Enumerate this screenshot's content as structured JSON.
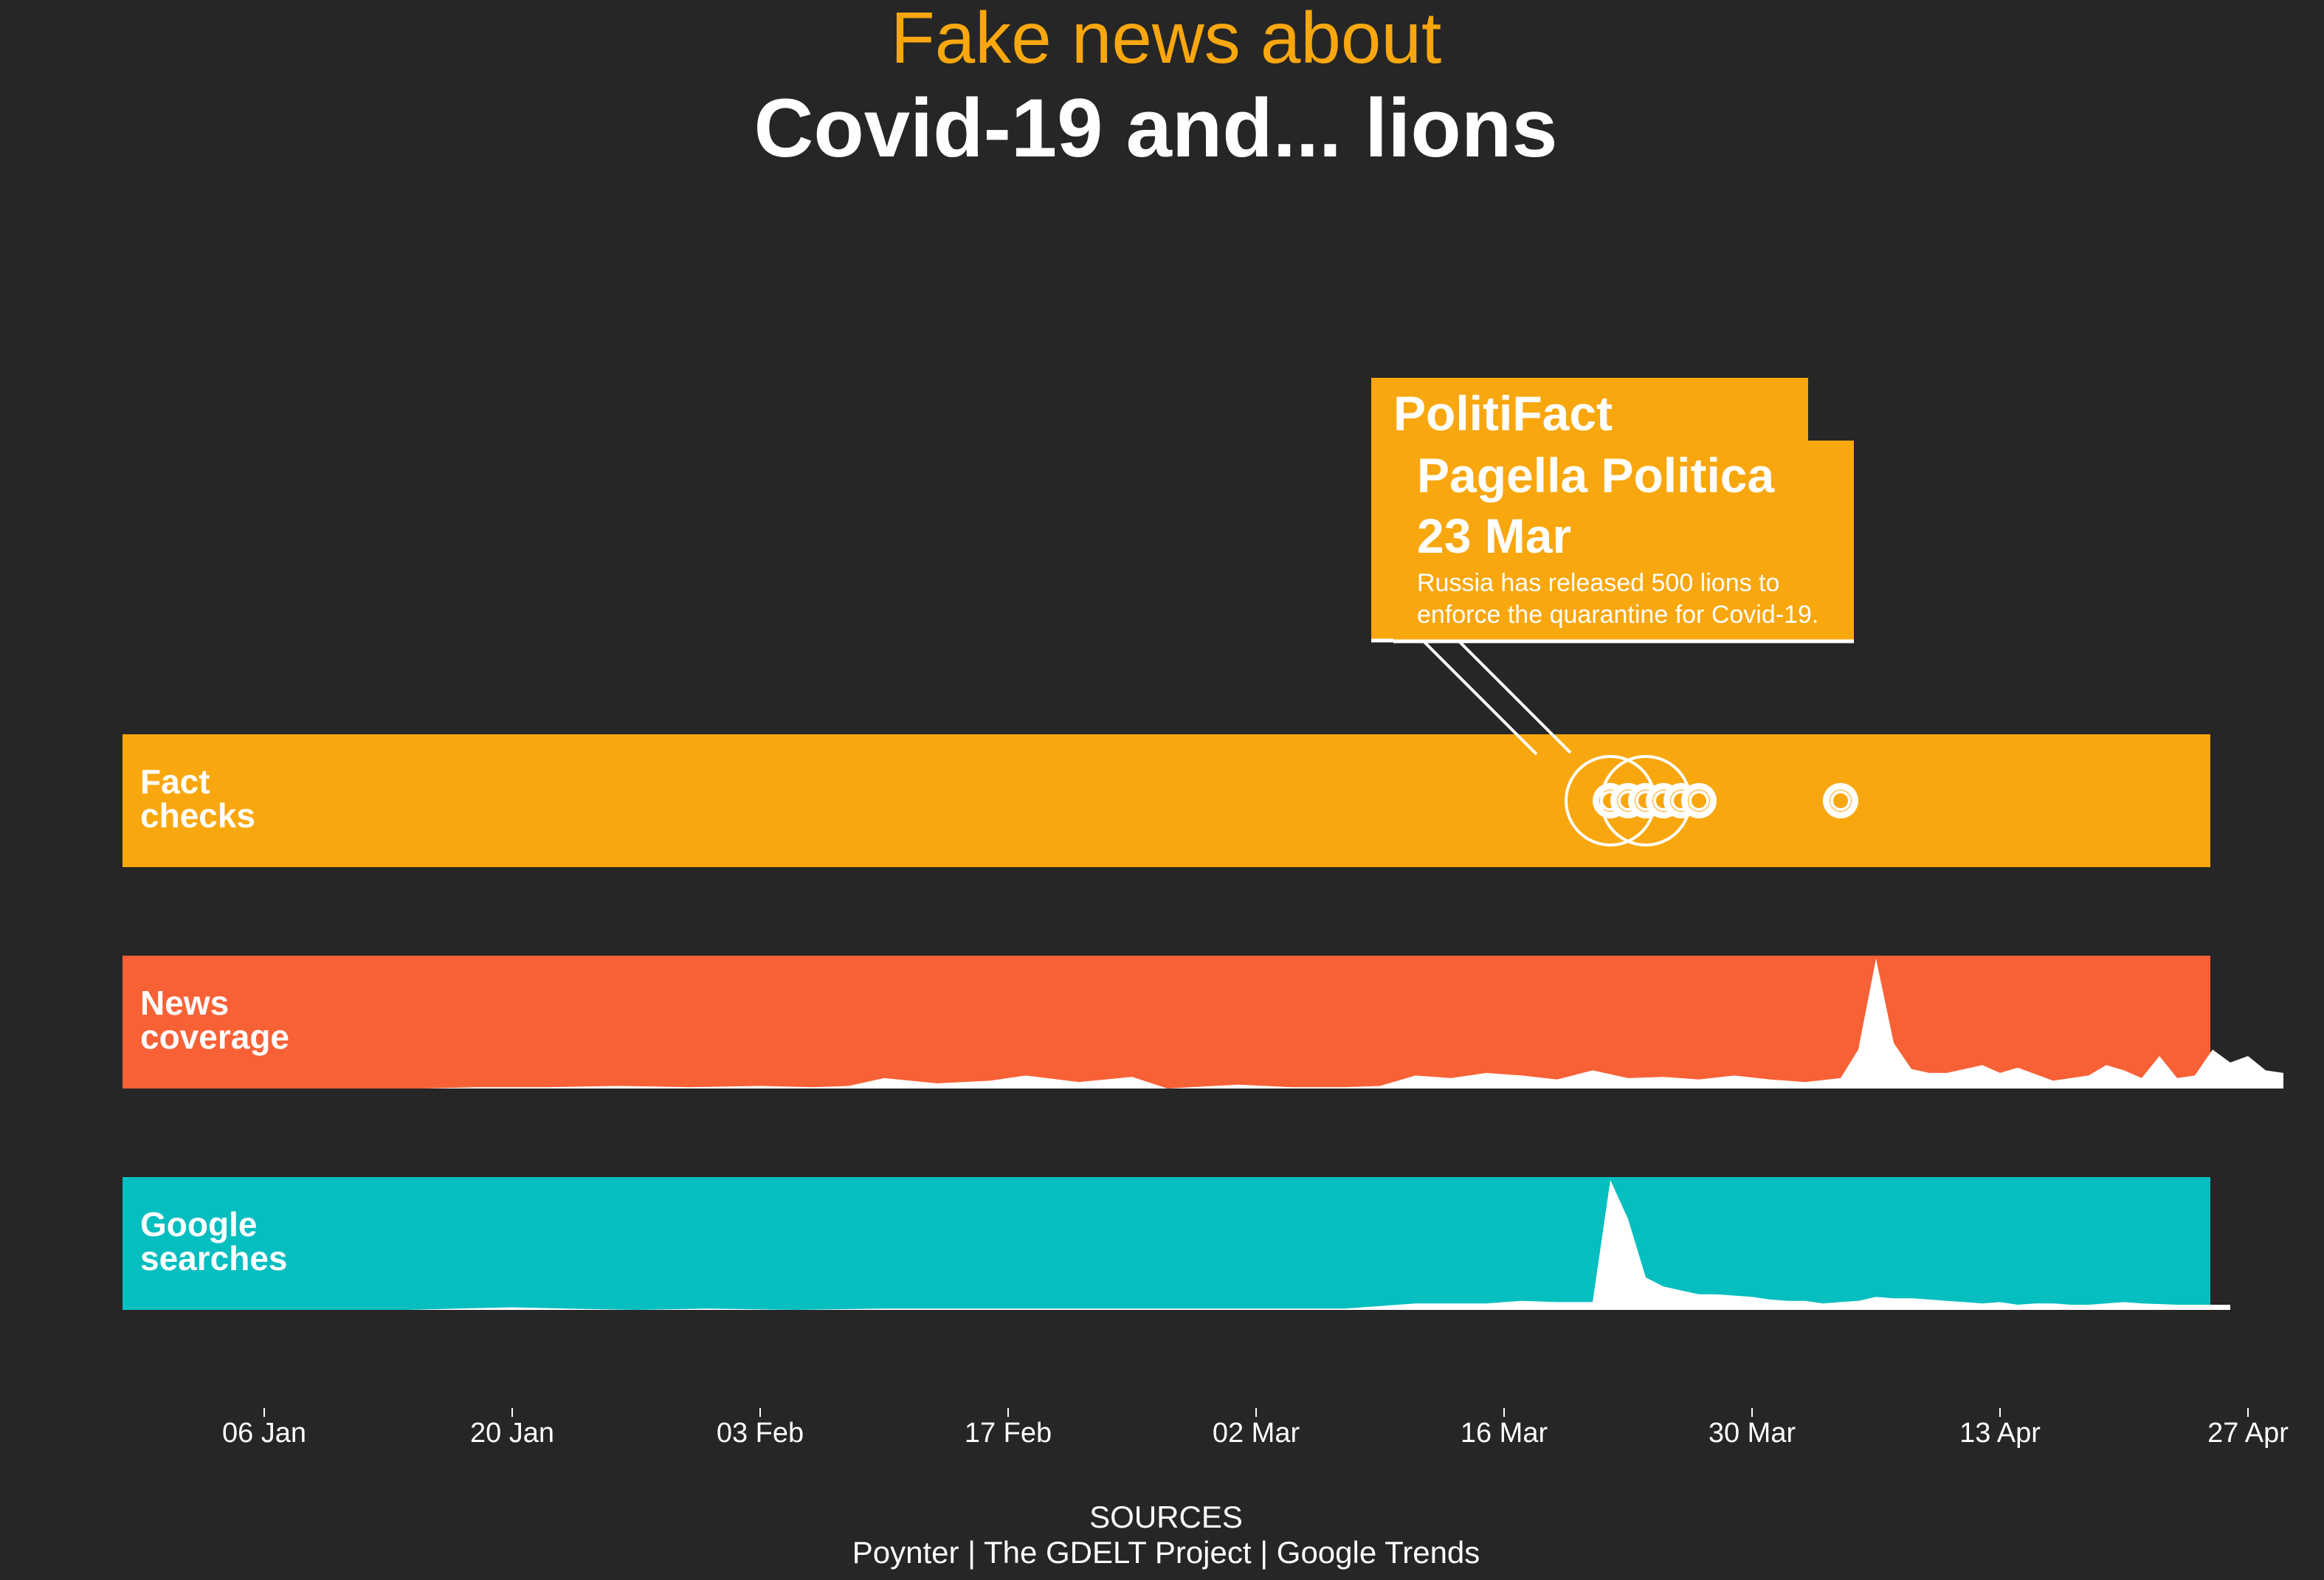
{
  "title": {
    "line1": "Fake news about",
    "line2": "Covid-19 and...  lions"
  },
  "colors": {
    "background": "#262626",
    "fact_checks": "#f9a70e",
    "news": "#f86136",
    "google": "#04bec0",
    "fill": "#ffffff"
  },
  "chart_data": {
    "type": "area",
    "x_axis": {
      "range": [
        "2019-12-29",
        "2020-04-29"
      ],
      "ticks": [
        "2020-01-06",
        "2020-01-20",
        "2020-02-03",
        "2020-02-17",
        "2020-03-02",
        "2020-03-16",
        "2020-03-30",
        "2020-04-13",
        "2020-04-27"
      ],
      "tick_labels": [
        "06 Jan",
        "20 Jan",
        "03 Feb",
        "17 Feb",
        "02 Mar",
        "16 Mar",
        "30 Mar",
        "13 Apr",
        "27 Apr"
      ]
    },
    "bands": [
      {
        "label_line1": "Fact",
        "label_line2": "checks",
        "kind": "points",
        "points": [
          {
            "date": "2020-03-22",
            "size": 3
          },
          {
            "date": "2020-03-22",
            "size": 1
          },
          {
            "date": "2020-03-23",
            "size": 1
          },
          {
            "date": "2020-03-24",
            "size": 3
          },
          {
            "date": "2020-03-24",
            "size": 1
          },
          {
            "date": "2020-03-25",
            "size": 1
          },
          {
            "date": "2020-03-26",
            "size": 1
          },
          {
            "date": "2020-03-27",
            "size": 1
          },
          {
            "date": "2020-04-04",
            "size": 1
          }
        ]
      },
      {
        "label_line1": "News",
        "label_line2": "coverage",
        "kind": "area",
        "x": [
          "2020-01-15",
          "2020-01-18",
          "2020-01-22",
          "2020-01-26",
          "2020-01-30",
          "2020-02-03",
          "2020-02-06",
          "2020-02-08",
          "2020-02-10",
          "2020-02-13",
          "2020-02-16",
          "2020-02-18",
          "2020-02-21",
          "2020-02-24",
          "2020-02-26",
          "2020-03-01",
          "2020-03-04",
          "2020-03-07",
          "2020-03-09",
          "2020-03-11",
          "2020-03-13",
          "2020-03-15",
          "2020-03-17",
          "2020-03-19",
          "2020-03-21",
          "2020-03-23",
          "2020-03-25",
          "2020-03-27",
          "2020-03-29",
          "2020-03-31",
          "2020-04-02",
          "2020-04-04",
          "2020-04-05",
          "2020-04-06",
          "2020-04-07",
          "2020-04-08",
          "2020-04-09",
          "2020-04-10",
          "2020-04-12",
          "2020-04-13",
          "2020-04-14",
          "2020-04-16",
          "2020-04-18",
          "2020-04-19",
          "2020-04-20",
          "2020-04-21",
          "2020-04-22",
          "2020-04-23",
          "2020-04-24",
          "2020-04-25",
          "2020-04-26",
          "2020-04-27",
          "2020-04-28",
          "2020-04-29"
        ],
        "values": [
          0,
          1,
          1,
          2,
          1,
          2,
          1,
          2,
          8,
          4,
          6,
          10,
          5,
          9,
          0,
          3,
          1,
          1,
          2,
          10,
          8,
          12,
          10,
          7,
          14,
          8,
          9,
          7,
          10,
          7,
          5,
          8,
          30,
          100,
          35,
          15,
          12,
          12,
          18,
          12,
          16,
          6,
          10,
          18,
          14,
          8,
          25,
          8,
          10,
          30,
          20,
          25,
          14,
          12
        ]
      },
      {
        "label_line1": "Google",
        "label_line2": "searches",
        "kind": "area",
        "x": [
          "2020-01-14",
          "2020-01-17",
          "2020-01-20",
          "2020-01-23",
          "2020-01-27",
          "2020-01-31",
          "2020-02-05",
          "2020-02-10",
          "2020-02-15",
          "2020-02-20",
          "2020-02-24",
          "2020-02-28",
          "2020-03-03",
          "2020-03-07",
          "2020-03-09",
          "2020-03-11",
          "2020-03-13",
          "2020-03-15",
          "2020-03-17",
          "2020-03-19",
          "2020-03-21",
          "2020-03-22",
          "2020-03-23",
          "2020-03-24",
          "2020-03-25",
          "2020-03-26",
          "2020-03-27",
          "2020-03-28",
          "2020-03-29",
          "2020-03-30",
          "2020-03-31",
          "2020-04-01",
          "2020-04-02",
          "2020-04-03",
          "2020-04-04",
          "2020-04-05",
          "2020-04-06",
          "2020-04-07",
          "2020-04-08",
          "2020-04-09",
          "2020-04-10",
          "2020-04-11",
          "2020-04-12",
          "2020-04-13",
          "2020-04-14",
          "2020-04-15",
          "2020-04-16",
          "2020-04-17",
          "2020-04-18",
          "2020-04-19",
          "2020-04-20",
          "2020-04-21",
          "2020-04-23",
          "2020-04-26"
        ],
        "values": [
          0,
          1,
          2,
          1,
          0,
          1,
          0,
          1,
          1,
          1,
          1,
          1,
          1,
          1,
          3,
          5,
          5,
          5,
          7,
          6,
          6,
          100,
          70,
          25,
          18,
          15,
          12,
          12,
          11,
          10,
          8,
          7,
          7,
          5,
          6,
          7,
          10,
          9,
          9,
          8,
          7,
          6,
          5,
          6,
          4,
          5,
          5,
          4,
          4,
          5,
          6,
          5,
          4,
          4
        ]
      }
    ],
    "tooltip": {
      "back": {
        "source": "PolitiFact"
      },
      "front": {
        "source": "Pagella Politica",
        "date": "23 Mar",
        "text_line1": "Russia has released 500 lions to",
        "text_line2": "enforce the quarantine for Covid-19."
      }
    }
  },
  "sources": {
    "heading": "SOURCES",
    "line": "Poynter | The GDELT Project | Google Trends"
  }
}
